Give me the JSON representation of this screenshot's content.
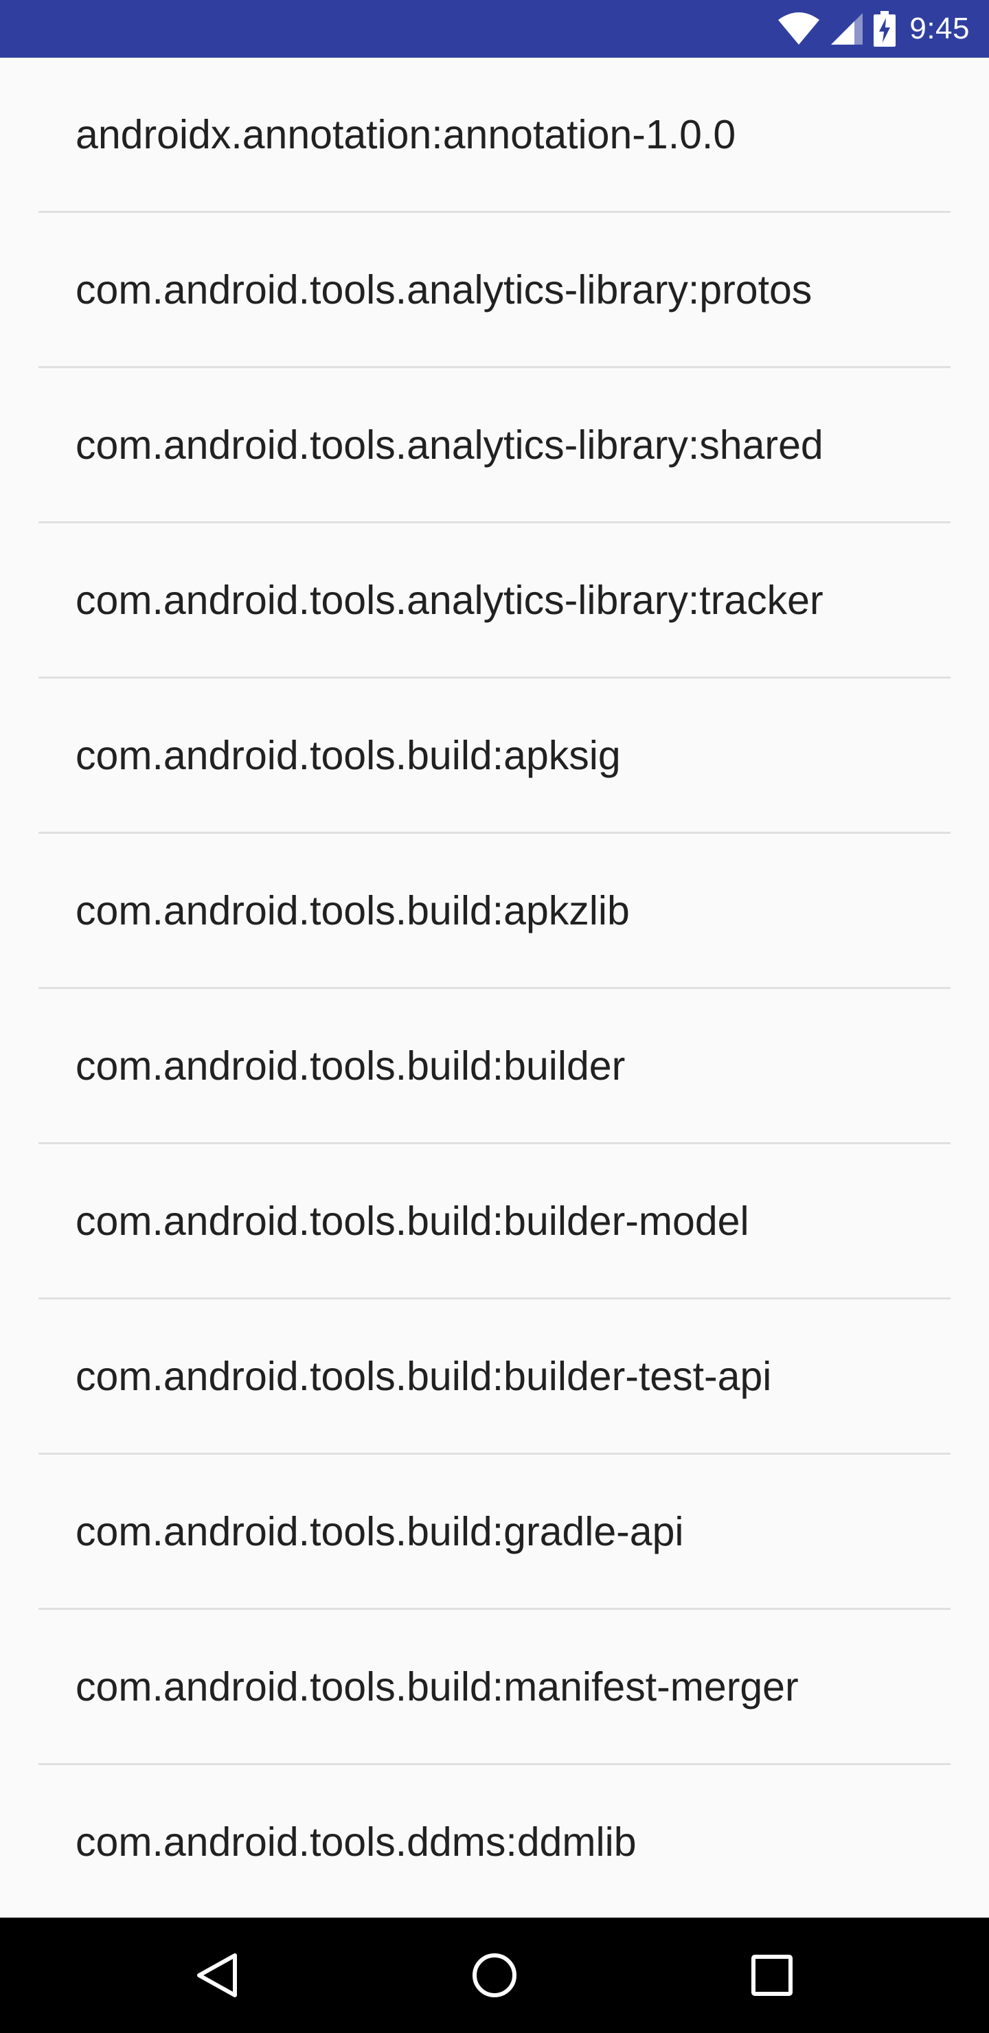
{
  "status_bar": {
    "time": "9:45",
    "color": "#303f9f",
    "icons": [
      "wifi-icon",
      "cell-signal-icon",
      "battery-charging-icon"
    ]
  },
  "list": {
    "items": [
      {
        "label": "androidx.annotation:annotation-1.0.0"
      },
      {
        "label": "com.android.tools.analytics-library:protos"
      },
      {
        "label": "com.android.tools.analytics-library:shared"
      },
      {
        "label": "com.android.tools.analytics-library:tracker"
      },
      {
        "label": "com.android.tools.build:apksig"
      },
      {
        "label": "com.android.tools.build:apkzlib"
      },
      {
        "label": "com.android.tools.build:builder"
      },
      {
        "label": "com.android.tools.build:builder-model"
      },
      {
        "label": "com.android.tools.build:builder-test-api"
      },
      {
        "label": "com.android.tools.build:gradle-api"
      },
      {
        "label": "com.android.tools.build:manifest-merger"
      },
      {
        "label": "com.android.tools.ddms:ddmlib"
      }
    ]
  },
  "nav_bar": {
    "buttons": [
      "back-icon",
      "home-icon",
      "recents-icon"
    ]
  }
}
